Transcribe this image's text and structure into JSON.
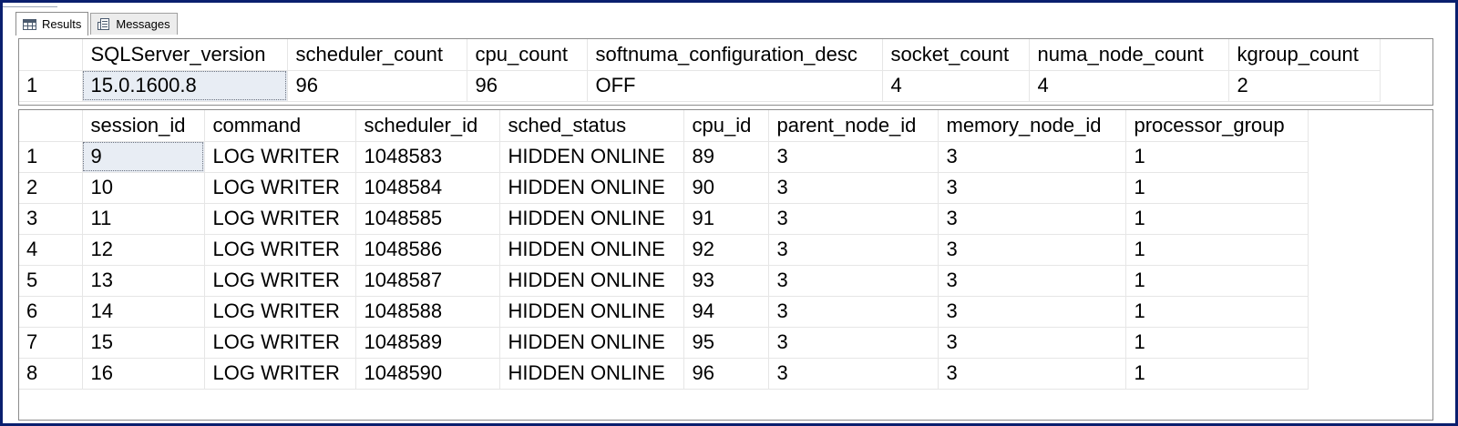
{
  "tabs": [
    {
      "label": "Results",
      "icon": "results-grid-icon",
      "active": true
    },
    {
      "label": "Messages",
      "icon": "messages-icon",
      "active": false
    }
  ],
  "result1": {
    "columns": [
      "",
      "SQLServer_version",
      "scheduler_count",
      "cpu_count",
      "softnuma_configuration_desc",
      "socket_count",
      "numa_node_count",
      "kgroup_count"
    ],
    "rows": [
      [
        "1",
        "15.0.1600.8",
        "96",
        "96",
        "OFF",
        "4",
        "4",
        "2"
      ]
    ]
  },
  "result2": {
    "columns": [
      "",
      "session_id",
      "command",
      "scheduler_id",
      "sched_status",
      "cpu_id",
      "parent_node_id",
      "memory_node_id",
      "processor_group"
    ],
    "rows": [
      [
        "1",
        "9",
        "LOG WRITER",
        "1048583",
        "HIDDEN ONLINE",
        "89",
        "3",
        "3",
        "1"
      ],
      [
        "2",
        "10",
        "LOG WRITER",
        "1048584",
        "HIDDEN ONLINE",
        "90",
        "3",
        "3",
        "1"
      ],
      [
        "3",
        "11",
        "LOG WRITER",
        "1048585",
        "HIDDEN ONLINE",
        "91",
        "3",
        "3",
        "1"
      ],
      [
        "4",
        "12",
        "LOG WRITER",
        "1048586",
        "HIDDEN ONLINE",
        "92",
        "3",
        "3",
        "1"
      ],
      [
        "5",
        "13",
        "LOG WRITER",
        "1048587",
        "HIDDEN ONLINE",
        "93",
        "3",
        "3",
        "1"
      ],
      [
        "6",
        "14",
        "LOG WRITER",
        "1048588",
        "HIDDEN ONLINE",
        "94",
        "3",
        "3",
        "1"
      ],
      [
        "7",
        "15",
        "LOG WRITER",
        "1048589",
        "HIDDEN ONLINE",
        "95",
        "3",
        "3",
        "1"
      ],
      [
        "8",
        "16",
        "LOG WRITER",
        "1048590",
        "HIDDEN ONLINE",
        "96",
        "3",
        "3",
        "1"
      ]
    ]
  },
  "colors": {
    "frame_border": "#0a1f6e",
    "selected_cell": "#e8edf4",
    "grid_line": "#e6e6e6"
  }
}
